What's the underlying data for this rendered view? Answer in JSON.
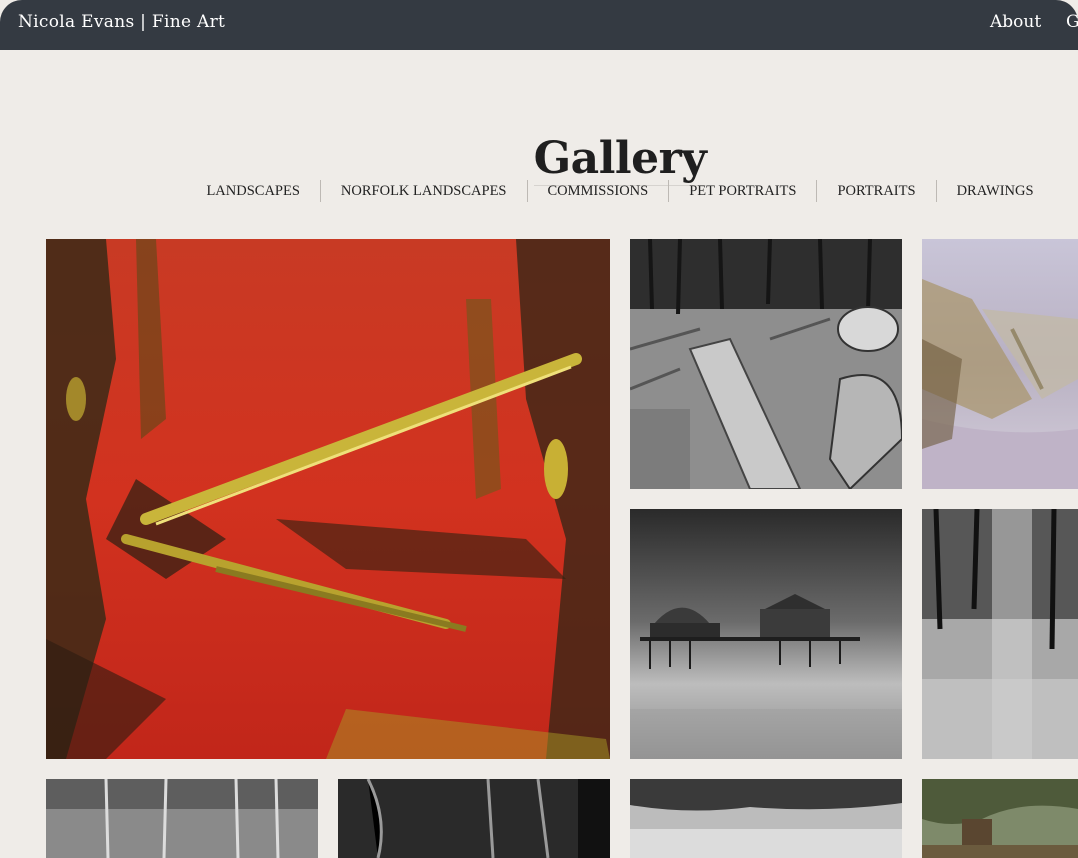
{
  "header": {
    "brand": "Nicola Evans | Fine Art",
    "nav": {
      "about": "About",
      "next_partial": "G"
    }
  },
  "page_title": "Gallery",
  "filters": [
    "LANDSCAPES",
    "NORFOLK LANDSCAPES",
    "COMMISSIONS",
    "PET PORTRAITS",
    "PORTRAITS",
    "DRAWINGS"
  ],
  "colors": {
    "header_bg": "#343a42",
    "page_bg": "#efece8",
    "painting_red": "#c8301f"
  }
}
